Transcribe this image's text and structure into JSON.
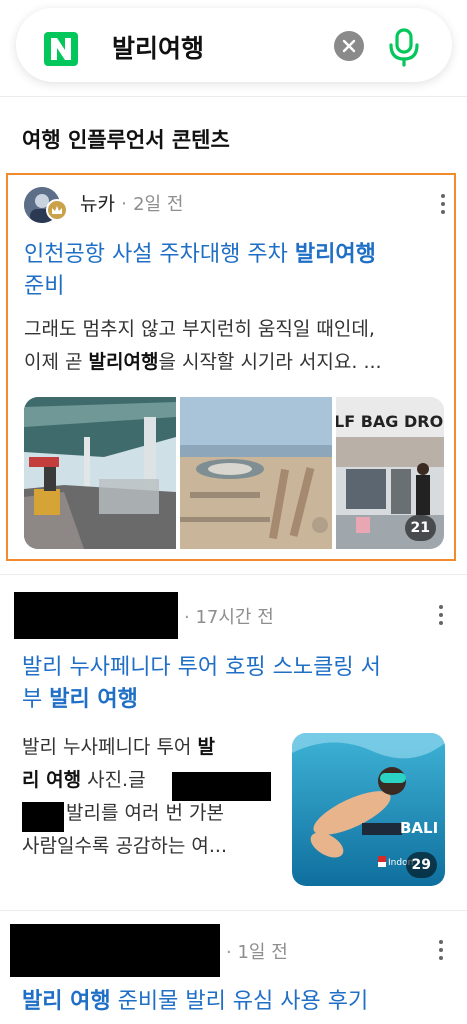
{
  "search": {
    "query": "발리여행"
  },
  "section": {
    "title": "여행 인플루언서 콘텐츠"
  },
  "card1": {
    "author": "뉴카",
    "time": "2일 전",
    "title_plain": "인천공항 사설 주차대행 주차 ",
    "title_bold": "발리여행",
    "title_line2": "준비",
    "snippet_line1": "그래도 멈추지 않고 부지런히 움직일 때인데,",
    "snippet_line2_pre": "이제 곧 ",
    "snippet_line2_bold": "발리여행",
    "snippet_line2_post": "을 시작할 시기라 서지요. ...",
    "photo_sign": "LF BAG DROP",
    "image_count": "21"
  },
  "card2": {
    "time": "17시간 전",
    "title_line1": "발리 누사페니다 투어 호핑 스노클링 서",
    "title_line2_pre": "부 ",
    "title_line2_bold": "발리 여행",
    "snippet_line1_pre": "발리 누사페니다 투어 ",
    "snippet_line1_bold": "발",
    "snippet_line2_bold": "리 여행",
    "snippet_line2_post": " 사진.글",
    "snippet_line3": "발리를 여러 번 가본",
    "snippet_line4": "사람일수록 공감하는 여...",
    "photo_caption": "BALI",
    "photo_sub": "Indon",
    "image_count": "29"
  },
  "card3": {
    "time": "1일 전",
    "title_bold": "발리 여행",
    "title_rest": " 준비물 발리 유심 사용 후기"
  },
  "colors": {
    "brand_green": "#03c75a",
    "link_blue": "#1f6fc6",
    "highlight_orange": "#f28b2c"
  }
}
